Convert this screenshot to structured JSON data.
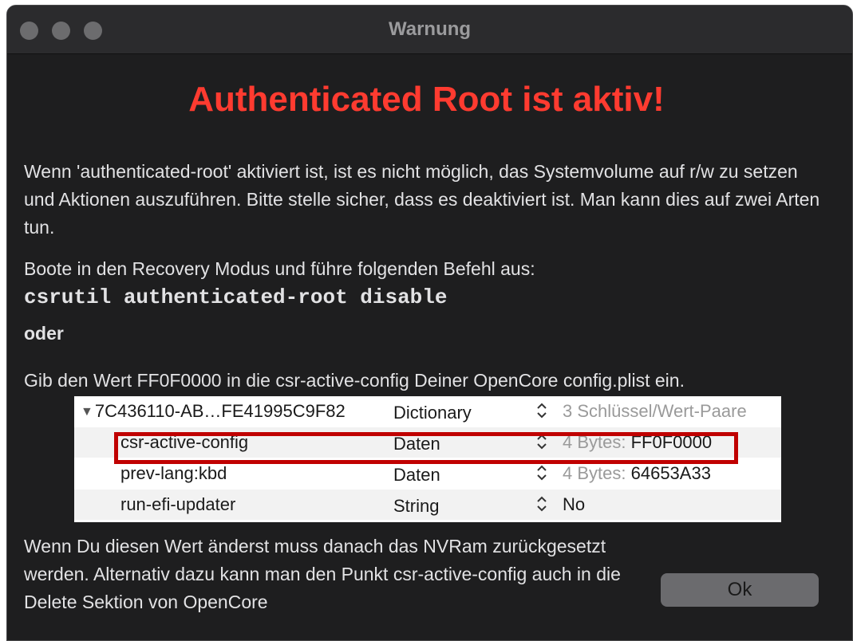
{
  "window": {
    "title": "Warnung"
  },
  "headline": "Authenticated Root ist aktiv!",
  "paragraphs": {
    "intro": "Wenn 'authenticated-root' aktiviert ist, ist es nicht möglich, das Systemvolume auf r/w zu setzen und Aktionen auszuführen. Bitte stelle sicher, dass es deaktiviert ist. Man kann dies auf zwei Arten tun.",
    "recovery": "Boote in den Recovery Modus und führe folgenden Befehl aus:",
    "command": "csrutil authenticated-root disable",
    "oder": "oder",
    "config": "Gib den Wert FF0F0000 in die csr-active-config Deiner OpenCore config.plist ein.",
    "nvram": "Wenn Du diesen Wert änderst muss danach das NVRam zurückgesetzt werden. Alternativ dazu kann man den Punkt csr-active-config auch in die Delete Sektion von OpenCore"
  },
  "plist": {
    "rows": [
      {
        "key": "7C436110-AB…FE41995C9F82",
        "type": "Dictionary",
        "value_prefix": "3 Schlüssel/Wert-Paare",
        "value": ""
      },
      {
        "key": "csr-active-config",
        "type": "Daten",
        "value_prefix": "4 Bytes:",
        "value": "FF0F0000"
      },
      {
        "key": "prev-lang:kbd",
        "type": "Daten",
        "value_prefix": "4 Bytes:",
        "value": "64653A33"
      },
      {
        "key": "run-efi-updater",
        "type": "String",
        "value_prefix": "",
        "value": "No"
      }
    ],
    "highlight_color": "#c00000"
  },
  "buttons": {
    "ok_label": "Ok"
  },
  "colors": {
    "headline": "#ff3b30",
    "background": "#1e1e1f"
  }
}
